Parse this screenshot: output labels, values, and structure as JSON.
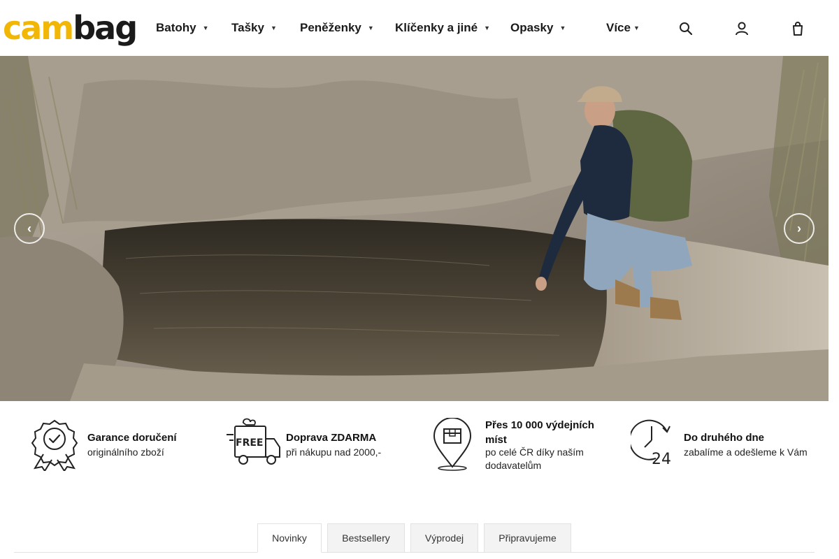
{
  "brand": {
    "logo_part1": "cam",
    "logo_part2": "bag",
    "accent": "#f2b705"
  },
  "nav": {
    "items": [
      {
        "label": "Batohy",
        "caret": "▼"
      },
      {
        "label": "Tašky",
        "caret": "▼"
      },
      {
        "label": "Peněženky",
        "caret": "▼"
      },
      {
        "label": "Klíčenky a jiné",
        "caret": "▼"
      },
      {
        "label": "Opasky",
        "caret": "▼"
      },
      {
        "label": "Více",
        "caret": "▼"
      }
    ],
    "icons": [
      "search-icon",
      "user-icon",
      "cart-icon"
    ]
  },
  "hero": {
    "prev_glyph": "‹",
    "next_glyph": "›"
  },
  "features": [
    {
      "icon": "guarantee-badge-icon",
      "title": "Garance doručení",
      "subtitle": "originálního zboží"
    },
    {
      "icon": "free-delivery-truck-icon",
      "title": "Doprava ZDARMA",
      "subtitle": "při nákupu nad 2000,-",
      "icon_text": "FREE"
    },
    {
      "icon": "pickup-point-pin-icon",
      "title": "Přes 10 000 výdejních míst",
      "subtitle": "po celé ČR díky naším dodavatelům"
    },
    {
      "icon": "clock-24-icon",
      "title": "Do druhého dne",
      "subtitle": "zabalíme a odešleme k Vám",
      "icon_text": "24"
    }
  ],
  "tabs": [
    {
      "label": "Novinky",
      "active": true
    },
    {
      "label": "Bestsellery",
      "active": false
    },
    {
      "label": "Výprodej",
      "active": false
    },
    {
      "label": "Připravujeme",
      "active": false
    }
  ]
}
